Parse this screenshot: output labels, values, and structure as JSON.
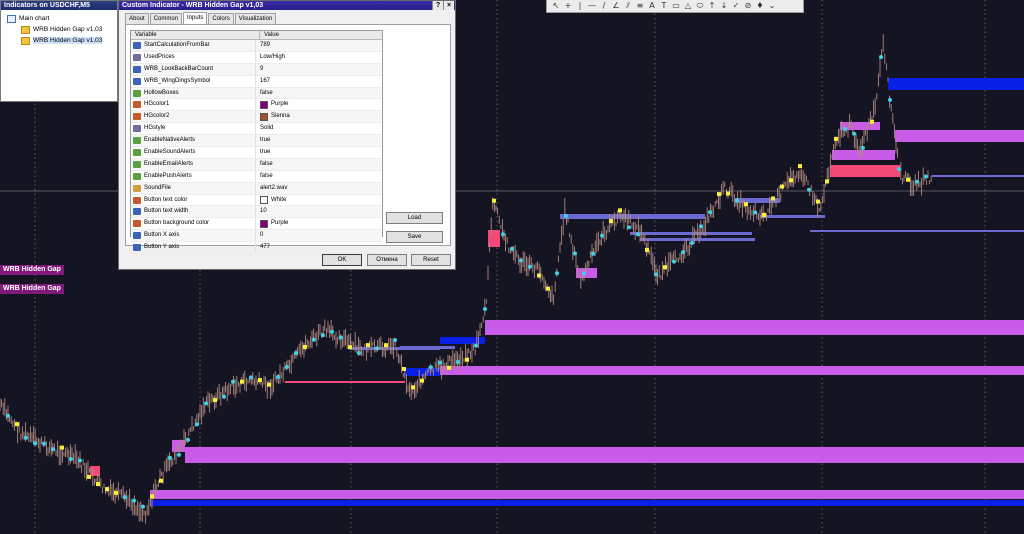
{
  "colors": {
    "chart_bg": "#151422",
    "candle": "#b08a80",
    "violet": "#c85ce8",
    "blue": "#0a1fe6",
    "slate": "#6a6ad0",
    "red": "#f04a78",
    "yellow": "#f7f034",
    "cyan": "#3cd2e8",
    "grid": "#6e6e7a",
    "tag_bg": "#7f1a7a",
    "title_bar": "#2b1f8f"
  },
  "navigator": {
    "title": "Indicators on USDCHF,M5",
    "root": "Main chart",
    "children": [
      "WRB Hidden Gap v1,03",
      "WRB Hidden Gap v1,03"
    ]
  },
  "toolbar": {
    "icons": [
      "cursor-icon",
      "crosshair-icon",
      "vertical-line-icon",
      "horizontal-line-icon",
      "trend-line-icon",
      "angle-line-icon",
      "channel-icon",
      "fibonacci-icon",
      "text-icon",
      "label-icon",
      "rectangle-icon",
      "triangle-icon",
      "ellipse-icon",
      "arrow-up-icon",
      "arrow-down-icon",
      "check-icon",
      "stop-icon",
      "thumbs-up-icon",
      "more-icon"
    ],
    "glyphs": [
      "↖",
      "+",
      "|",
      "—",
      "/",
      "∠",
      "⫽",
      "≡",
      "A",
      "T",
      "▭",
      "△",
      "⬭",
      "↑",
      "↓",
      "✓",
      "⊘",
      "♦",
      "⌄"
    ]
  },
  "dialog": {
    "title": "Custom Indicator - WRB Hidden Gap v1,03",
    "help_btn": "?",
    "close_btn": "×",
    "tabs": [
      "About",
      "Common",
      "Inputs",
      "Colors",
      "Visualization"
    ],
    "active_tab": "Inputs",
    "grid_header": {
      "variable": "Variable",
      "value": "Value"
    },
    "rows": [
      {
        "name": "StartCalculationFromBar",
        "value": "789",
        "type": "int"
      },
      {
        "name": "UsedPrices",
        "value": "Low/High",
        "type": "enum"
      },
      {
        "name": "WRB_LookBackBarCount",
        "value": "9",
        "type": "int"
      },
      {
        "name": "WRB_WingDingsSymbol",
        "value": "167",
        "type": "int"
      },
      {
        "name": "HollowBoxes",
        "value": "false",
        "type": "bool"
      },
      {
        "name": "HGcolor1",
        "value": "Purple",
        "type": "col",
        "swatch": "#800080"
      },
      {
        "name": "HGcolor2",
        "value": "Sienna",
        "type": "col",
        "swatch": "#a0522d"
      },
      {
        "name": "HGstyle",
        "value": "Solid",
        "type": "enum"
      },
      {
        "name": "EnableNativeAlerts",
        "value": "true",
        "type": "bool"
      },
      {
        "name": "EnableSoundAlerts",
        "value": "true",
        "type": "bool"
      },
      {
        "name": "EnableEmailAlerts",
        "value": "false",
        "type": "bool"
      },
      {
        "name": "EnablePushAlerts",
        "value": "false",
        "type": "bool"
      },
      {
        "name": "SoundFile",
        "value": "alert2.wav",
        "type": "str"
      },
      {
        "name": "Button text color",
        "value": "White",
        "type": "col",
        "swatch": "#ffffff"
      },
      {
        "name": "Button text width",
        "value": "10",
        "type": "int"
      },
      {
        "name": "Button background color",
        "value": "Purple",
        "type": "col",
        "swatch": "#800080"
      },
      {
        "name": "Button X axis",
        "value": "0",
        "type": "int"
      },
      {
        "name": "Button Y axis",
        "value": "477",
        "type": "int"
      }
    ],
    "buttons": {
      "load": "Load",
      "save": "Save",
      "ok": "OK",
      "cancel": "Отмена",
      "reset": "Reset"
    }
  },
  "chart_tags": [
    "WRB Hidden Gap",
    "WRB Hidden Gap"
  ]
}
